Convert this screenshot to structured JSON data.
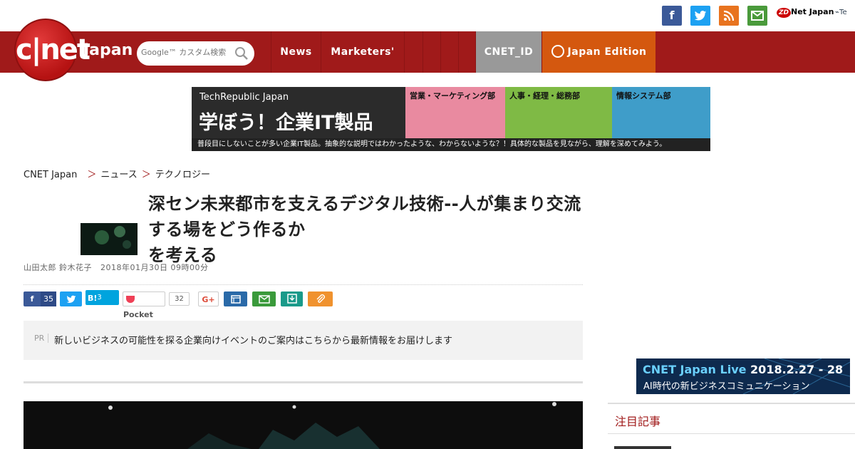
{
  "header": {
    "social_icons": [
      {
        "name": "facebook-icon",
        "glyph": "f",
        "color": "#3b5998"
      },
      {
        "name": "twitter-icon",
        "glyph": "t",
        "color": "#1da1f2"
      },
      {
        "name": "rss-icon",
        "glyph": ")",
        "color": "#e8731f"
      },
      {
        "name": "mail-icon",
        "glyph": "✉",
        "color": "#4a9a3b"
      }
    ],
    "zdnet_label": "Net Japan",
    "zdnet_badge": "ZD",
    "tech_label": "Te"
  },
  "nav": {
    "logo_text": "c|net",
    "logo_sub": "Japan",
    "search_placeholder": "Google™ カスタム検索",
    "items": [
      "News",
      "Marketers'"
    ],
    "cnet_id": "CNET_ID",
    "japan_edition": "Japan Edition",
    "colors": {
      "bar": "#a01a1a",
      "cnet_id": "#999999",
      "japan_edition": "#d4580f"
    }
  },
  "banner": {
    "brand": "TechRepublic Japan",
    "headline": "学ぼう！企業IT製品",
    "panel_labels": [
      "営業・マーケティング部",
      "人事・経理・総務部",
      "情報システム部"
    ],
    "footer": "普段目にしないことが多い企業IT製品。抽象的な説明ではわかったような、わからないような？！具体的な製品を見ながら、理解を深めてみよう。"
  },
  "breadcrumb": {
    "items": [
      "CNET Japan",
      "＞",
      "ニュース",
      "＞",
      "テクノロジー"
    ]
  },
  "article": {
    "title": "深セン未来都市を支えるデジタル技術--人が集まり交流する場をどう作るか",
    "title_line2": "を考える",
    "byline": "山田太郎 鈴木花子",
    "date": "2018年01月30日 09時00分"
  },
  "share": {
    "facebook_count": "35",
    "hatena_label": "B!",
    "hatena_count": "3",
    "pocket_label": "Pocket",
    "pocket_count": "32",
    "google_label": "G+"
  },
  "pr": {
    "tag": "PR",
    "text": "新しいビジネスの可能性を探る企業向けイベントのご案内はこちらから最新情報をお届けします"
  },
  "sidebar": {
    "ad_title_en": "CNET Japan Live",
    "ad_date": "2018.2.27 - 28",
    "ad_sub": "AI時代の新ビジネスコミュニケーション",
    "section_title": "注目記事"
  }
}
